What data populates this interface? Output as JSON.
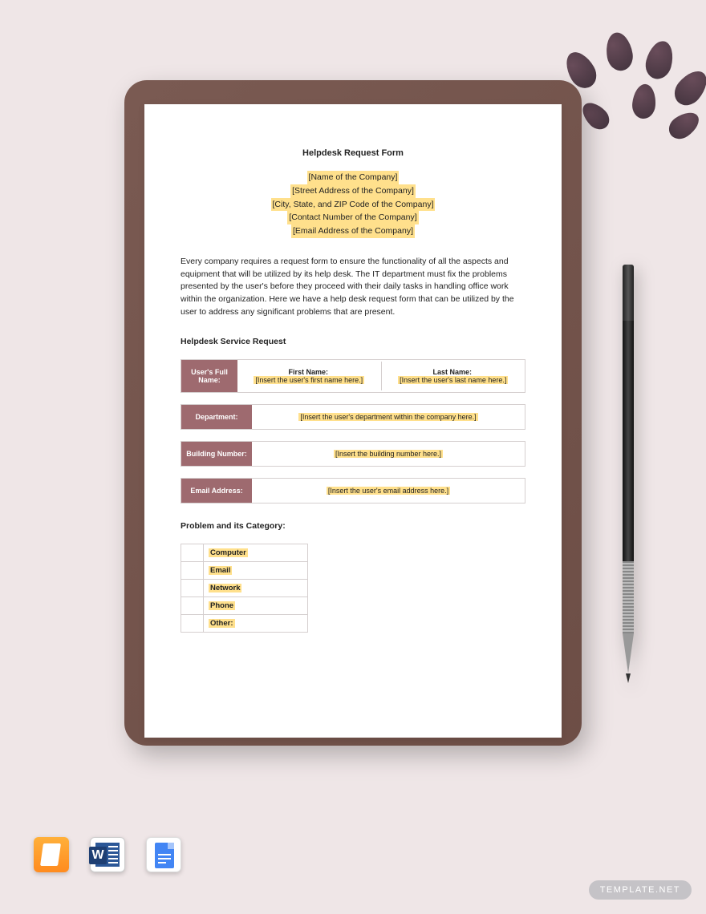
{
  "doc": {
    "title": "Helpdesk Request Form",
    "company": {
      "name": "[Name of the Company]",
      "street": "[Street Address of the Company]",
      "city": "[City, State, and ZIP Code of the Company]",
      "phone": "[Contact Number of the Company]",
      "email": "[Email Address of the Company]"
    },
    "intro": "Every company requires a request form to ensure the functionality of all the aspects and equipment that will be utilized by its help desk. The IT department must fix the problems presented by the user's before they proceed with their daily tasks in handling office work within the organization. Here we have a help desk request form that can be utilized by the user to address any significant problems that are present.",
    "section_service": "Helpdesk Service Request",
    "fields": {
      "full_name_label": "User's Full Name:",
      "first_name_label": "First Name:",
      "first_name_value": "[Insert the user's first name here.]",
      "last_name_label": "Last Name:",
      "last_name_value": "[Insert the user's last name here.]",
      "department_label": "Department:",
      "department_value": "[Insert the user's department within the company here.]",
      "building_label": "Building Number:",
      "building_value": "[Insert the building number here.]",
      "email_label": "Email Address:",
      "email_value": "[Insert the user's email address here.]"
    },
    "section_problem": "Problem and its Category:",
    "categories": [
      "Computer",
      "Email",
      "Network",
      "Phone",
      "Other:"
    ]
  },
  "icons": {
    "pages": "pages-app",
    "word": "ms-word-app",
    "gdocs": "google-docs-app"
  },
  "watermark": "TEMPLATE.NET"
}
